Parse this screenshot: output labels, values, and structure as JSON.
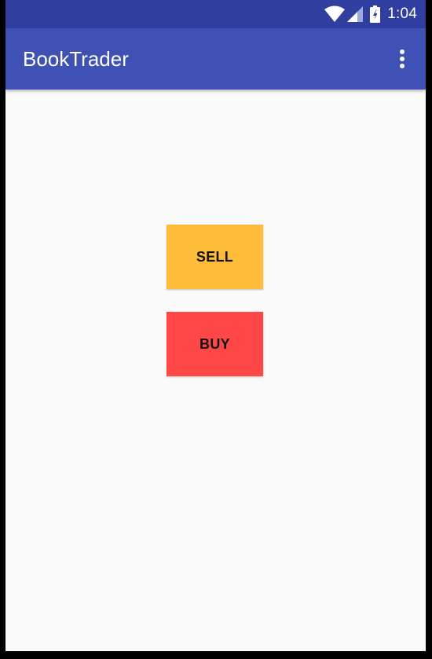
{
  "status_bar": {
    "time": "1:04",
    "icons": [
      "wifi-icon",
      "cell-signal-icon",
      "battery-charging-icon"
    ]
  },
  "app_bar": {
    "title": "BookTrader",
    "menu_icon": "overflow-menu-icon"
  },
  "main": {
    "sell_label": "SELL",
    "buy_label": "BUY"
  },
  "colors": {
    "status_bar": "#303f9f",
    "app_bar": "#3f51b5",
    "background": "#fafafa",
    "sell_button": "#ffbc38",
    "buy_button": "#ff4747"
  }
}
